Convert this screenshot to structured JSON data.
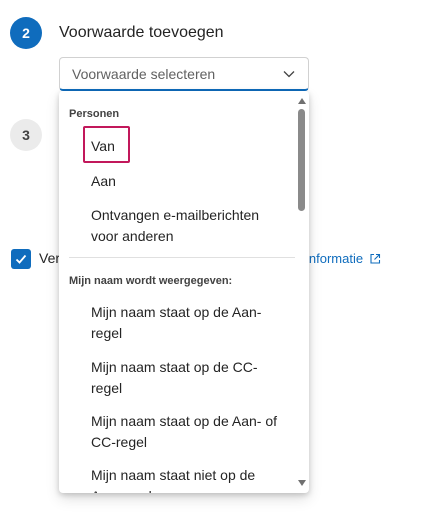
{
  "step2": {
    "number": "2",
    "title": "Voorwaarde toevoegen"
  },
  "step3": {
    "number": "3"
  },
  "select": {
    "placeholder": "Voorwaarde selecteren",
    "icon": "chevron-down-icon"
  },
  "checkbox": {
    "label": "Ver",
    "checked": true
  },
  "info_link": {
    "label": "informatie",
    "icon": "external-link-icon"
  },
  "dropdown": {
    "groups": [
      {
        "header": "Personen",
        "options": [
          "Van",
          "Aan",
          "Ontvangen e-mailberichten voor anderen"
        ]
      },
      {
        "header": "Mijn naam wordt weergegeven:",
        "options": [
          "Mijn naam staat op de Aan-regel",
          "Mijn naam staat op de CC-regel",
          "Mijn naam staat op de Aan- of CC-regel",
          "Mijn naam staat niet op de Aan-regel"
        ]
      }
    ],
    "focused_option": "Van"
  },
  "colors": {
    "accent": "#0f6cbd",
    "focus_outline": "#c2185b"
  }
}
